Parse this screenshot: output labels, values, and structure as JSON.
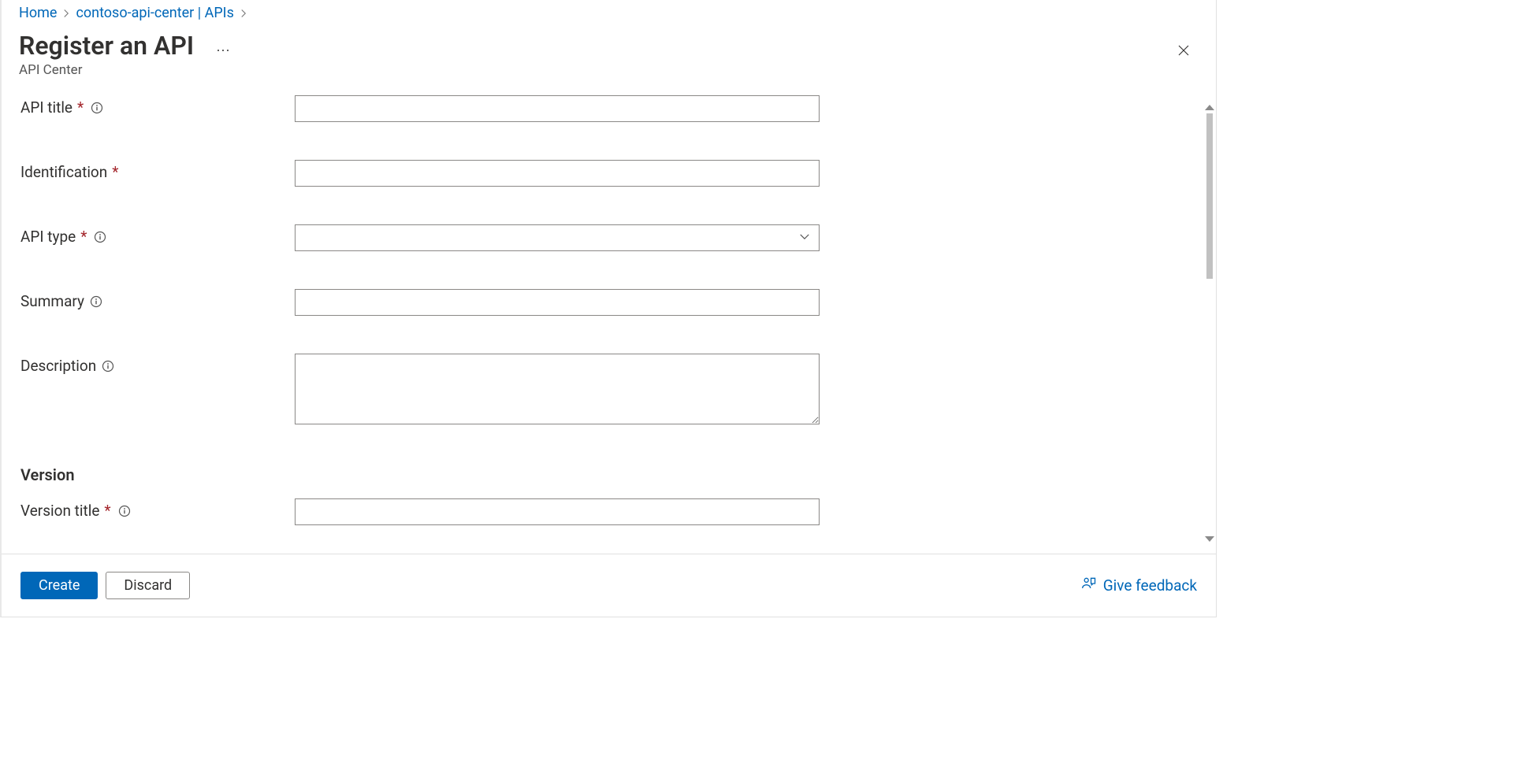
{
  "breadcrumb": {
    "home": "Home",
    "center": "contoso-api-center | APIs"
  },
  "header": {
    "title": "Register an API",
    "subtitle": "API Center"
  },
  "form": {
    "api_title": {
      "label": "API title",
      "value": ""
    },
    "identification": {
      "label": "Identification",
      "value": ""
    },
    "api_type": {
      "label": "API type",
      "value": ""
    },
    "summary": {
      "label": "Summary",
      "value": ""
    },
    "description": {
      "label": "Description",
      "value": ""
    },
    "version_section": "Version",
    "version_title": {
      "label": "Version title",
      "value": ""
    }
  },
  "footer": {
    "create": "Create",
    "discard": "Discard",
    "feedback": "Give feedback"
  }
}
